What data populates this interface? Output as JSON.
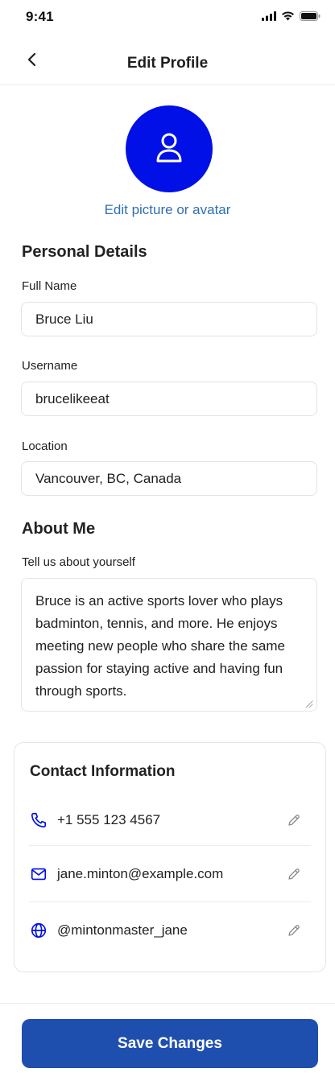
{
  "status_bar": {
    "time": "9:41"
  },
  "header": {
    "title": "Edit Profile",
    "back_icon": "chevron-left-icon"
  },
  "avatar": {
    "icon": "user-icon",
    "edit_link": "Edit picture or avatar",
    "color": "#0010e6"
  },
  "personal_details": {
    "title": "Personal Details",
    "full_name": {
      "label": "Full Name",
      "value": "Bruce Liu"
    },
    "username": {
      "label": "Username",
      "value": "brucelikeeat"
    },
    "location": {
      "label": "Location",
      "value": "Vancouver, BC, Canada"
    }
  },
  "about": {
    "title": "About Me",
    "label": "Tell us about yourself",
    "value": "Bruce is an active sports lover who plays badminton, tennis, and more. He enjoys meeting new people who share the same passion for staying active and having fun through sports."
  },
  "contact": {
    "title": "Contact Information",
    "items": [
      {
        "icon": "phone-icon",
        "value": "+1 555 123 4567",
        "edit_icon": "pencil-icon"
      },
      {
        "icon": "mail-icon",
        "value": "jane.minton@example.com",
        "edit_icon": "pencil-icon"
      },
      {
        "icon": "globe-icon",
        "value": "@mintonmaster_jane",
        "edit_icon": "pencil-icon"
      }
    ]
  },
  "footer": {
    "save_label": "Save Changes",
    "button_color": "#1f4fae"
  },
  "colors": {
    "accent_blue": "#0010e6",
    "link_blue": "#2f6fb0"
  }
}
